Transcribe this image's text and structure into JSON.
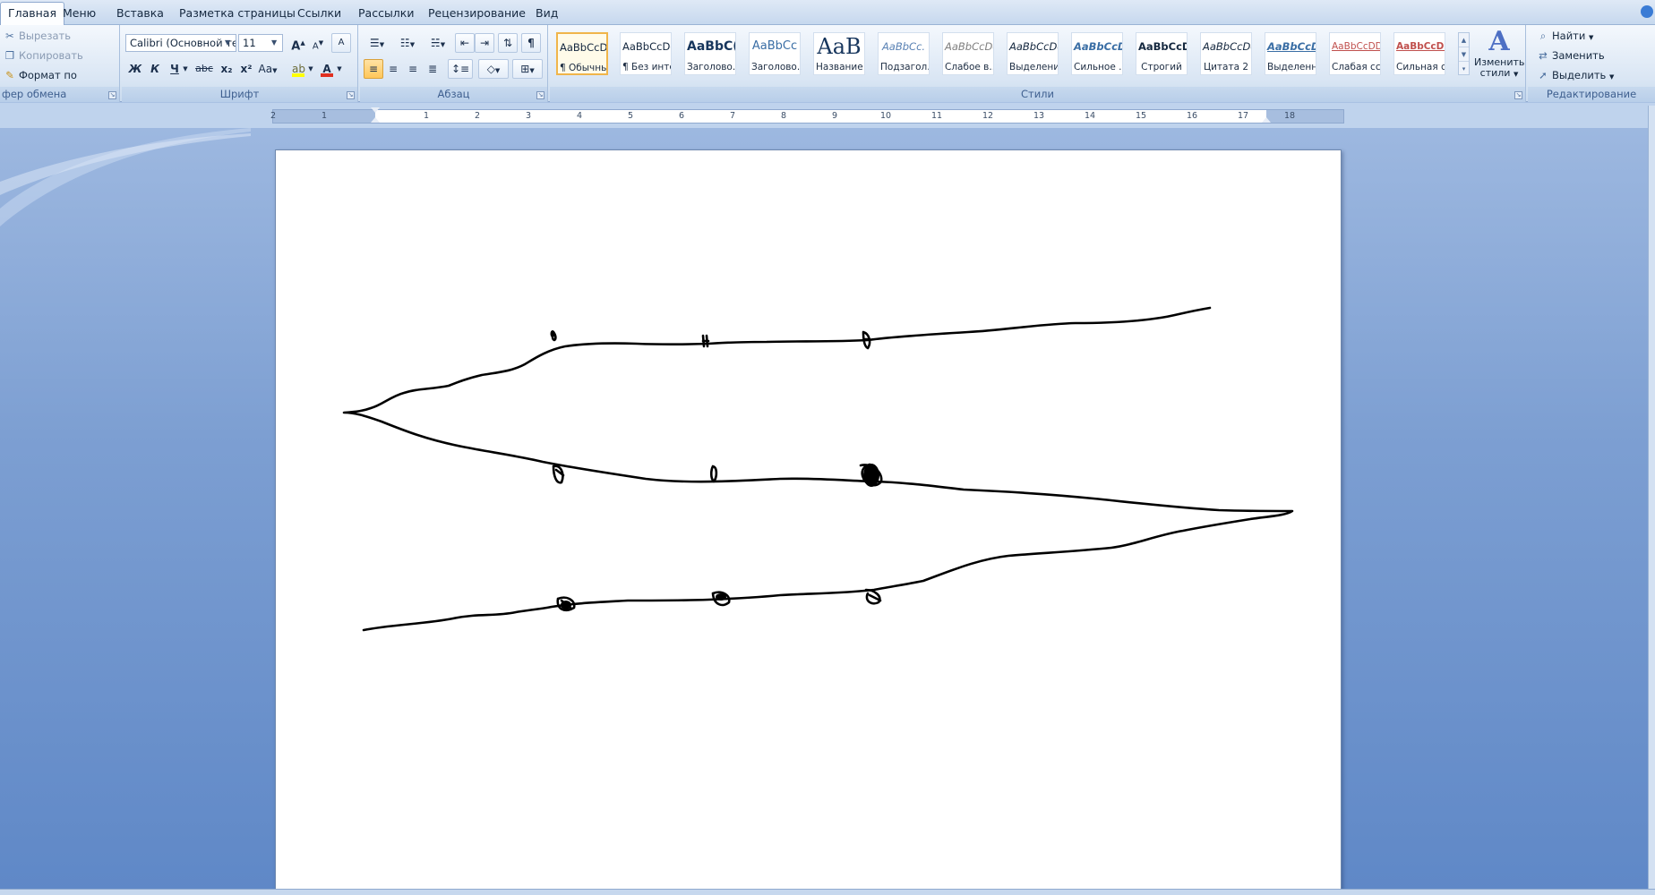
{
  "tabs": [
    "Главная",
    "Меню",
    "Вставка",
    "Разметка страницы",
    "Ссылки",
    "Рассылки",
    "Рецензирование",
    "Вид"
  ],
  "clipboard": {
    "label": "фер обмена",
    "cut": "Вырезать",
    "copy": "Копировать",
    "format_painter": "Формат по образцу"
  },
  "font": {
    "label": "Шрифт",
    "name": "Calibri (Основной те",
    "size": "11",
    "bold": "Ж",
    "italic": "К",
    "underline": "Ч",
    "strike": "abc",
    "subscript": "x₂",
    "superscript": "x²",
    "case": "Aa",
    "grow": "A",
    "shrink": "A",
    "clear": "A"
  },
  "paragraph": {
    "label": "Абзац"
  },
  "styles": {
    "label": "Стили",
    "items": [
      {
        "sample": "AaBbCcDc",
        "name": "¶ Обычный"
      },
      {
        "sample": "AaBbCcDc",
        "name": "¶ Без инте..."
      },
      {
        "sample": "AaBbC(",
        "name": "Заголово..."
      },
      {
        "sample": "AaBbCc",
        "name": "Заголово..."
      },
      {
        "sample": "AaB",
        "name": "Название"
      },
      {
        "sample": "AaBbCc.",
        "name": "Подзагол..."
      },
      {
        "sample": "AaBbCcDc",
        "name": "Слабое в..."
      },
      {
        "sample": "AaBbCcDc",
        "name": "Выделение"
      },
      {
        "sample": "AaBbCcDc",
        "name": "Сильное ..."
      },
      {
        "sample": "AaBbCcDc",
        "name": "Строгий"
      },
      {
        "sample": "AaBbCcDc",
        "name": "Цитата 2"
      },
      {
        "sample": "AaBbCcDc",
        "name": "Выделенн..."
      },
      {
        "sample": "AaBbCcDD",
        "name": "Слабая сс..."
      },
      {
        "sample": "AaBbCcDD",
        "name": "Сильная с..."
      }
    ],
    "change_styles_line1": "Изменить",
    "change_styles_line2": "стили"
  },
  "editing": {
    "label": "Редактирование",
    "find": "Найти",
    "replace": "Заменить",
    "select": "Выделить"
  },
  "ruler": {
    "numbers": [
      "2",
      "1",
      "1",
      "2",
      "3",
      "4",
      "5",
      "6",
      "7",
      "8",
      "9",
      "10",
      "11",
      "12",
      "13",
      "14",
      "15",
      "16",
      "17",
      "18"
    ]
  },
  "colors": {
    "ribbon_bg": "#dae6f4",
    "doc_bg": "#7d9fd2",
    "highlight": "#ffff00",
    "font_color": "#e03020",
    "selected_style_border": "#f0b54a"
  }
}
